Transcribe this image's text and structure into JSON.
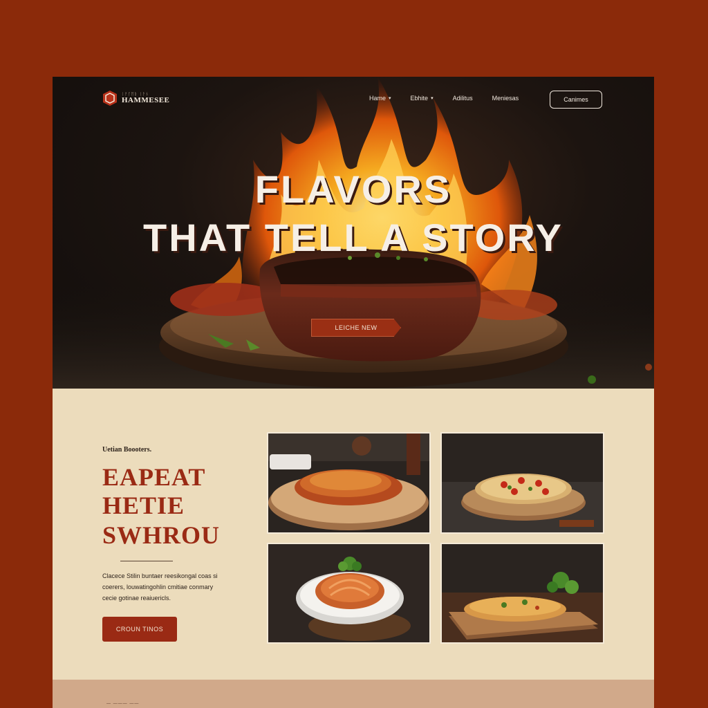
{
  "brand": {
    "tagline": "ᛁᚨᚴᛖᚱ ᛁᚨᚾ",
    "name": "HAMMESEE"
  },
  "nav": {
    "items": [
      {
        "label": "Hame",
        "has_dropdown": true
      },
      {
        "label": "Ebhite",
        "has_dropdown": true
      },
      {
        "label": "Adilitus",
        "has_dropdown": false
      },
      {
        "label": "Meniesas",
        "has_dropdown": false
      }
    ],
    "cta": "Canimes"
  },
  "hero": {
    "title_line1": "FLAVORS",
    "title_line2": "THAT TELL A STORY",
    "button": "LEICHE NEW"
  },
  "feature": {
    "eyebrow": "Uetian Boooters.",
    "headline": [
      "EAPEAT",
      "HETIE",
      "SWHROU"
    ],
    "body": [
      "Clacece Stilin buntaer reesikongal coas si",
      "coerers, louwatingohlin cmitiae conmary",
      "cecie gotinae reaiuericls."
    ],
    "button": "CROUN TINOS"
  },
  "gallery": [
    {
      "dish": "pasta-bowl"
    },
    {
      "dish": "pizza"
    },
    {
      "dish": "spaghetti"
    },
    {
      "dish": "flatbread"
    }
  ],
  "footer": {
    "text": "— ——— ——"
  },
  "colors": {
    "accent": "#9a2a14",
    "background": "#8b2a0a",
    "panel": "#ecdcbc"
  }
}
